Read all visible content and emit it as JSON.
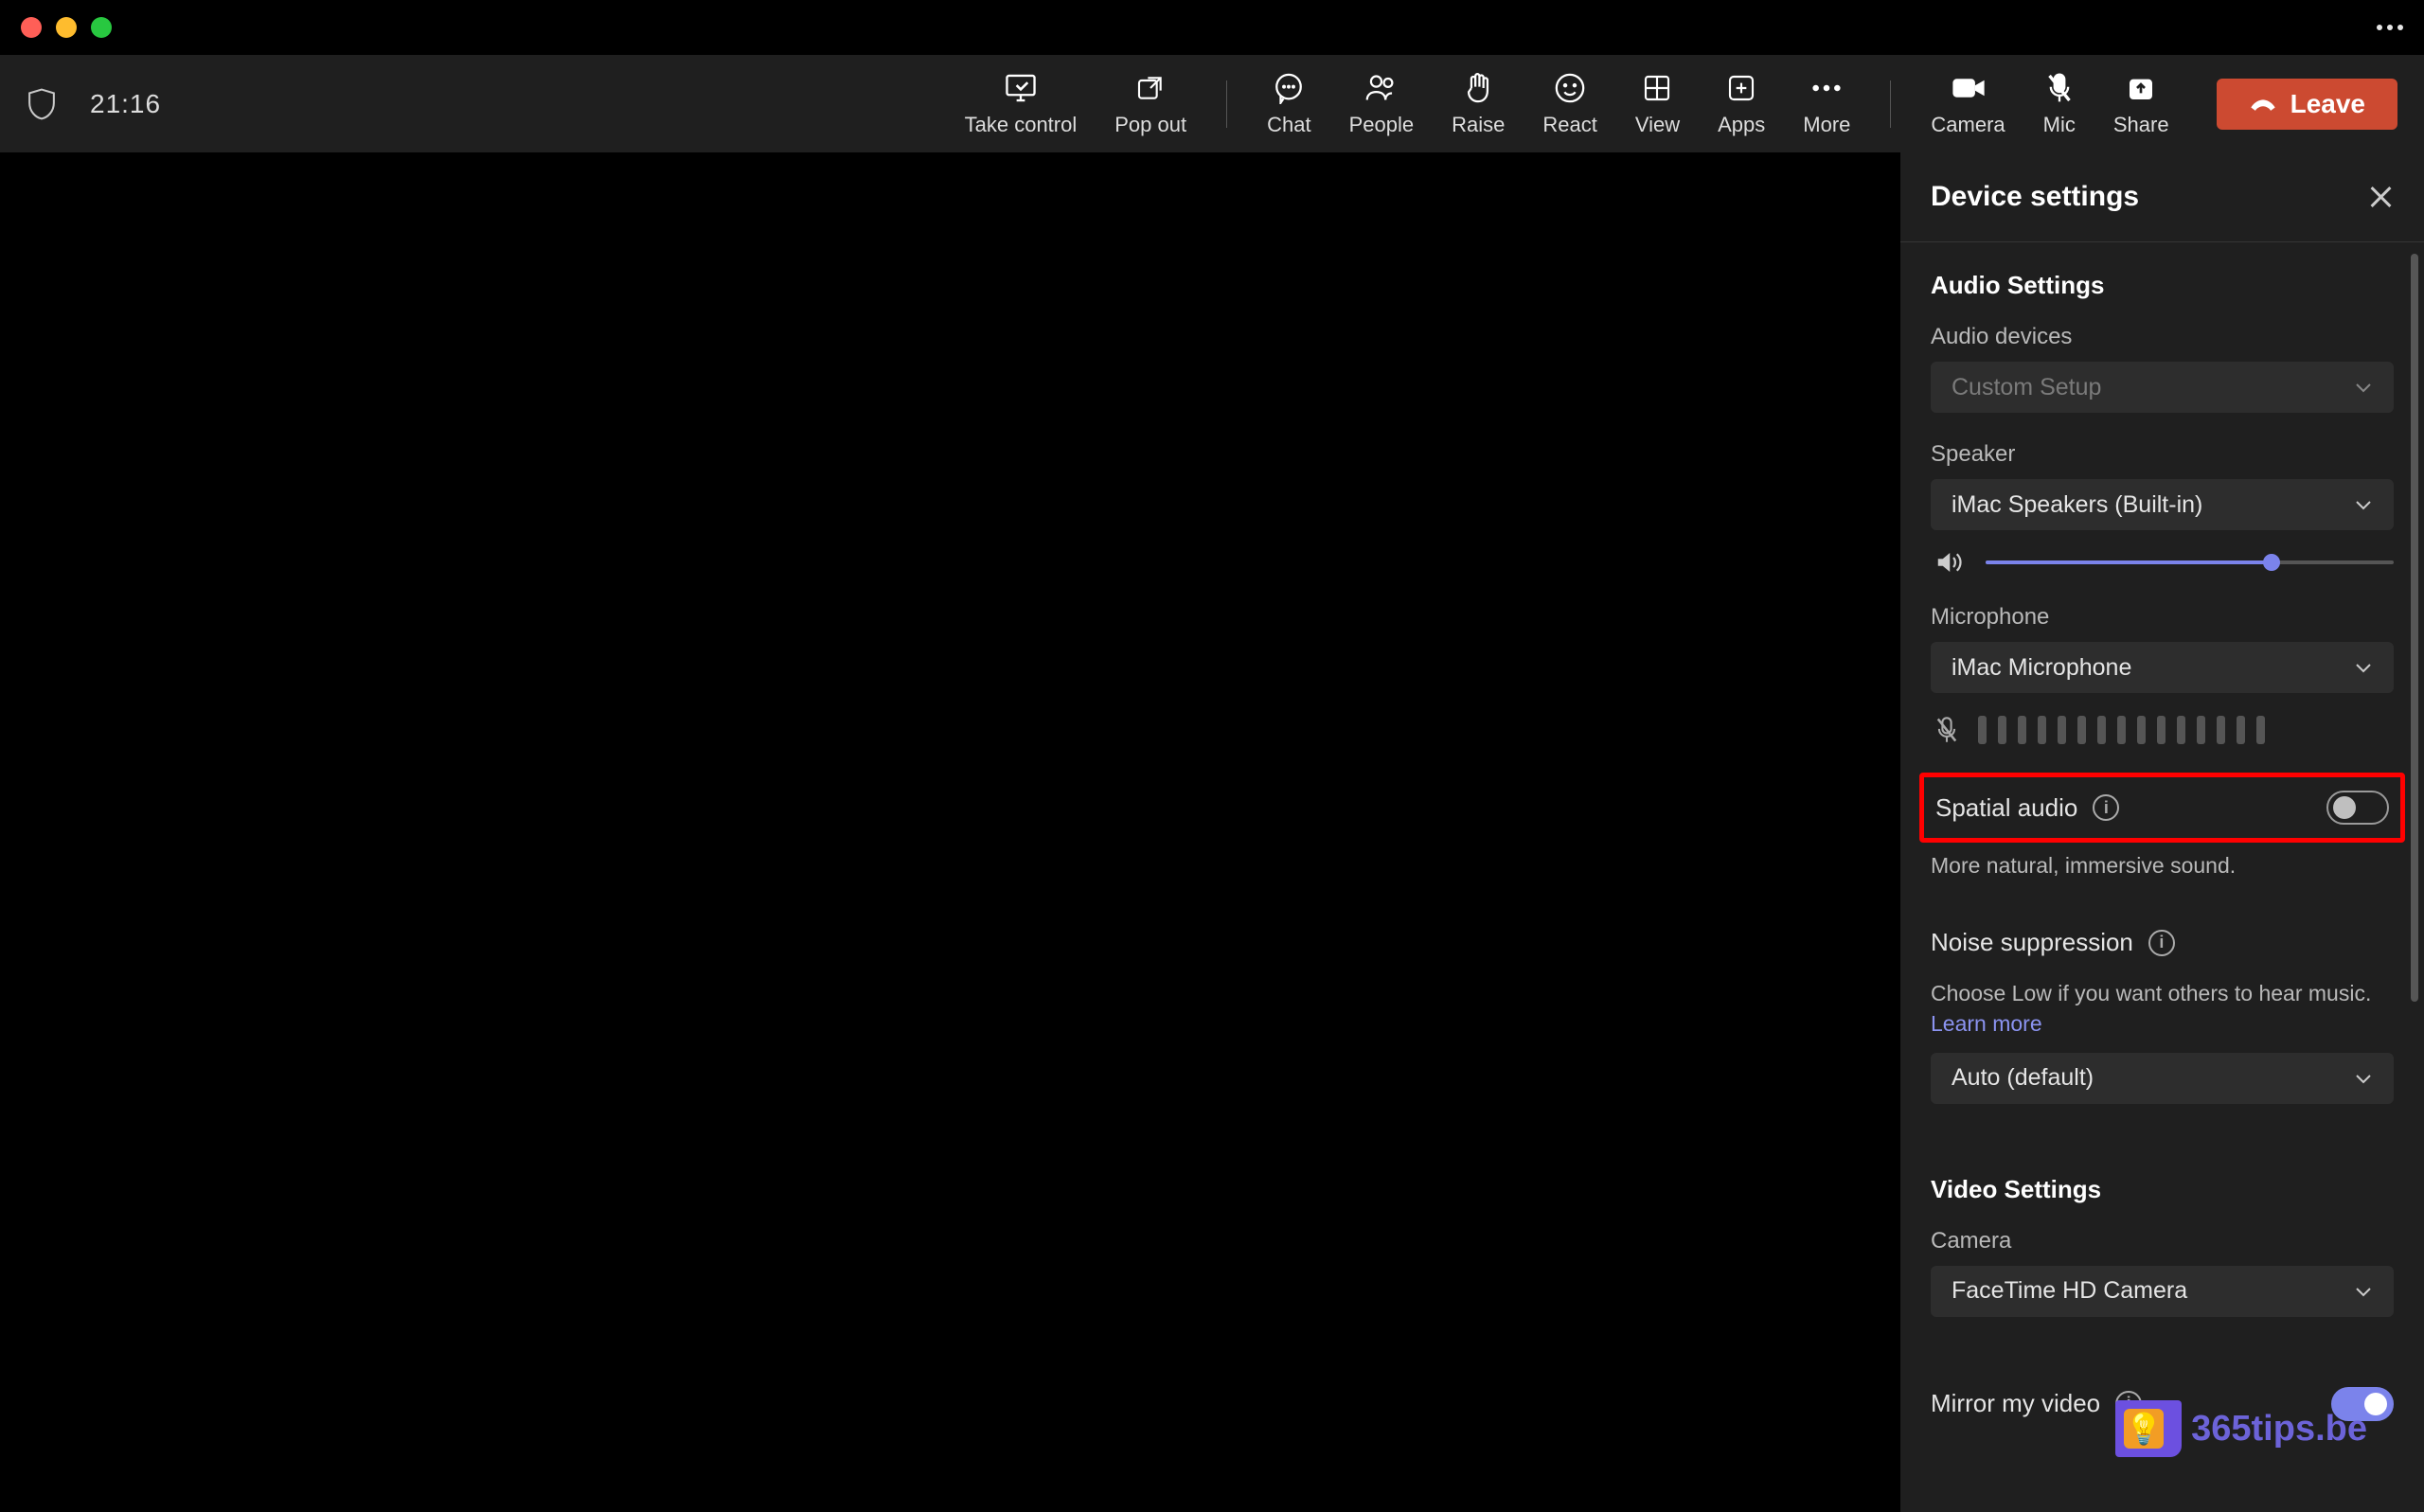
{
  "titlebar": {
    "duration": "21:16"
  },
  "toolbar": {
    "take_control": "Take control",
    "pop_out": "Pop out",
    "chat": "Chat",
    "people": "People",
    "raise": "Raise",
    "react": "React",
    "view": "View",
    "apps": "Apps",
    "more": "More",
    "camera": "Camera",
    "mic": "Mic",
    "share": "Share",
    "leave": "Leave"
  },
  "panel": {
    "title": "Device settings",
    "audio_section": "Audio Settings",
    "audio_devices_label": "Audio devices",
    "audio_devices_value": "Custom Setup",
    "speaker_label": "Speaker",
    "speaker_value": "iMac Speakers (Built-in)",
    "speaker_volume_percent": 70,
    "microphone_label": "Microphone",
    "microphone_value": "iMac Microphone",
    "spatial_audio_label": "Spatial audio",
    "spatial_audio_on": false,
    "spatial_desc": "More natural, immersive sound.",
    "noise_label": "Noise suppression",
    "noise_desc": "Choose Low if you want others to hear music. ",
    "noise_learn": "Learn more",
    "noise_value": "Auto (default)",
    "video_section": "Video Settings",
    "camera_label": "Camera",
    "camera_value": "FaceTime HD Camera",
    "mirror_label": "Mirror my video",
    "mirror_on": true
  },
  "watermark": "365tips.be"
}
